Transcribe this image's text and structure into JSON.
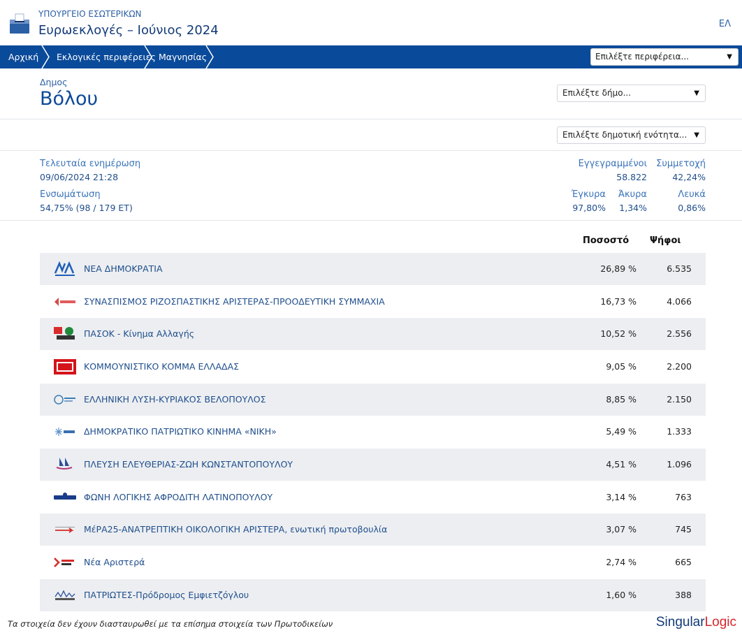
{
  "header": {
    "ministry": "ΥΠΟΥΡΓΕΙΟ ΕΣΩΤΕΡΙΚΩΝ",
    "title": "Ευρωεκλογές – Ιούνιος 2024",
    "lang": "ΕΛ"
  },
  "nav": {
    "crumbs": [
      "Αρχική",
      "Εκλογικές περιφέρειες",
      "Μαγνησίας"
    ],
    "region_select": "Επιλέξτε περιφέρεια..."
  },
  "municipality": {
    "label": "Δημος",
    "name": "Βόλου",
    "select_municipality": "Επιλέξτε δήμο...",
    "select_unit": "Επιλέξτε δημοτική ενότητα..."
  },
  "stats": {
    "last_update_label": "Τελευταία ενημέρωση",
    "last_update_value": "09/06/2024 21:28",
    "integration_label": "Ενσωμάτωση",
    "integration_value": "54,75% (98 / 179 ΕΤ)",
    "registered_label": "Εγγεγραμμένοι",
    "registered_value": "58.822",
    "turnout_label": "Συμμετοχή",
    "turnout_value": "42,24%",
    "valid_label": "Έγκυρα",
    "valid_value": "97,80%",
    "invalid_label": "Άκυρα",
    "invalid_value": "1,34%",
    "blank_label": "Λευκά",
    "blank_value": "0,86%"
  },
  "results": {
    "col_percent": "Ποσοστό",
    "col_votes": "Ψήφοι",
    "rows": [
      {
        "name": "ΝΕΑ ΔΗΜΟΚΡΑΤΙΑ",
        "percent": "26,89 %",
        "votes": "6.535",
        "logo": "nd-logo-icon"
      },
      {
        "name": "ΣΥΝΑΣΠΙΣΜΟΣ ΡΙΖΟΣΠΑΣΤΙΚΗΣ ΑΡΙΣΤΕΡΑΣ-ΠΡΟΟΔΕΥΤΙΚΗ ΣΥΜΜΑΧΙΑ",
        "percent": "16,73 %",
        "votes": "4.066",
        "logo": "syriza-logo-icon"
      },
      {
        "name": "ΠΑΣΟΚ - Κίνημα Αλλαγής",
        "percent": "10,52 %",
        "votes": "2.556",
        "logo": "pasok-logo-icon"
      },
      {
        "name": "ΚΟΜΜΟΥΝΙΣΤΙΚΟ ΚΟΜΜΑ ΕΛΛΑΔΑΣ",
        "percent": "9,05 %",
        "votes": "2.200",
        "logo": "kke-logo-icon"
      },
      {
        "name": "ΕΛΛΗΝΙΚΗ ΛΥΣΗ-ΚΥΡΙΑΚΟΣ ΒΕΛΟΠΟΥΛΟΣ",
        "percent": "8,85 %",
        "votes": "2.150",
        "logo": "elliniki-lysi-logo-icon"
      },
      {
        "name": "ΔΗΜΟΚΡΑΤΙΚΟ ΠΑΤΡΙΩΤΙΚΟ ΚΙΝΗΜΑ «ΝΙΚΗ»",
        "percent": "5,49 %",
        "votes": "1.333",
        "logo": "niki-logo-icon"
      },
      {
        "name": "ΠΛΕΥΣΗ ΕΛΕΥΘΕΡΙΑΣ-ΖΩΗ ΚΩΝΣΤΑΝΤΟΠΟΥΛΟΥ",
        "percent": "4,51 %",
        "votes": "1.096",
        "logo": "plefsi-logo-icon"
      },
      {
        "name": "ΦΩΝΗ ΛΟΓΙΚΗΣ ΑΦΡΟΔΙΤΗ ΛΑΤΙΝΟΠΟΥΛΟΥ",
        "percent": "3,14 %",
        "votes": "763",
        "logo": "foni-logikis-logo-icon"
      },
      {
        "name": "ΜέΡΑ25-ΑΝΑΤΡΕΠΤΙΚΗ ΟΙΚΟΛΟΓΙΚΗ ΑΡΙΣΤΕΡΑ, ενωτική πρωτοβουλία",
        "percent": "3,07 %",
        "votes": "745",
        "logo": "mera25-logo-icon"
      },
      {
        "name": "Νέα Αριστερά",
        "percent": "2,74 %",
        "votes": "665",
        "logo": "nea-aristera-logo-icon"
      },
      {
        "name": "ΠΑΤΡΙΩΤΕΣ-Πρόδρομος Εμφιετζόγλου",
        "percent": "1,60 %",
        "votes": "388",
        "logo": "patriotes-logo-icon"
      }
    ]
  },
  "footer": {
    "note": "Τα στοιχεία δεν έχουν διασταυρωθεί με τα επίσημα στοιχεία των Πρωτοδικείων",
    "brand_main": "Singular",
    "brand_accent": "Logic"
  },
  "colors": {
    "nav_bg": "#0a4a9a",
    "text_blue": "#1f4e8c",
    "row_alt": "#eceef1",
    "brand_red": "#d6262b"
  }
}
